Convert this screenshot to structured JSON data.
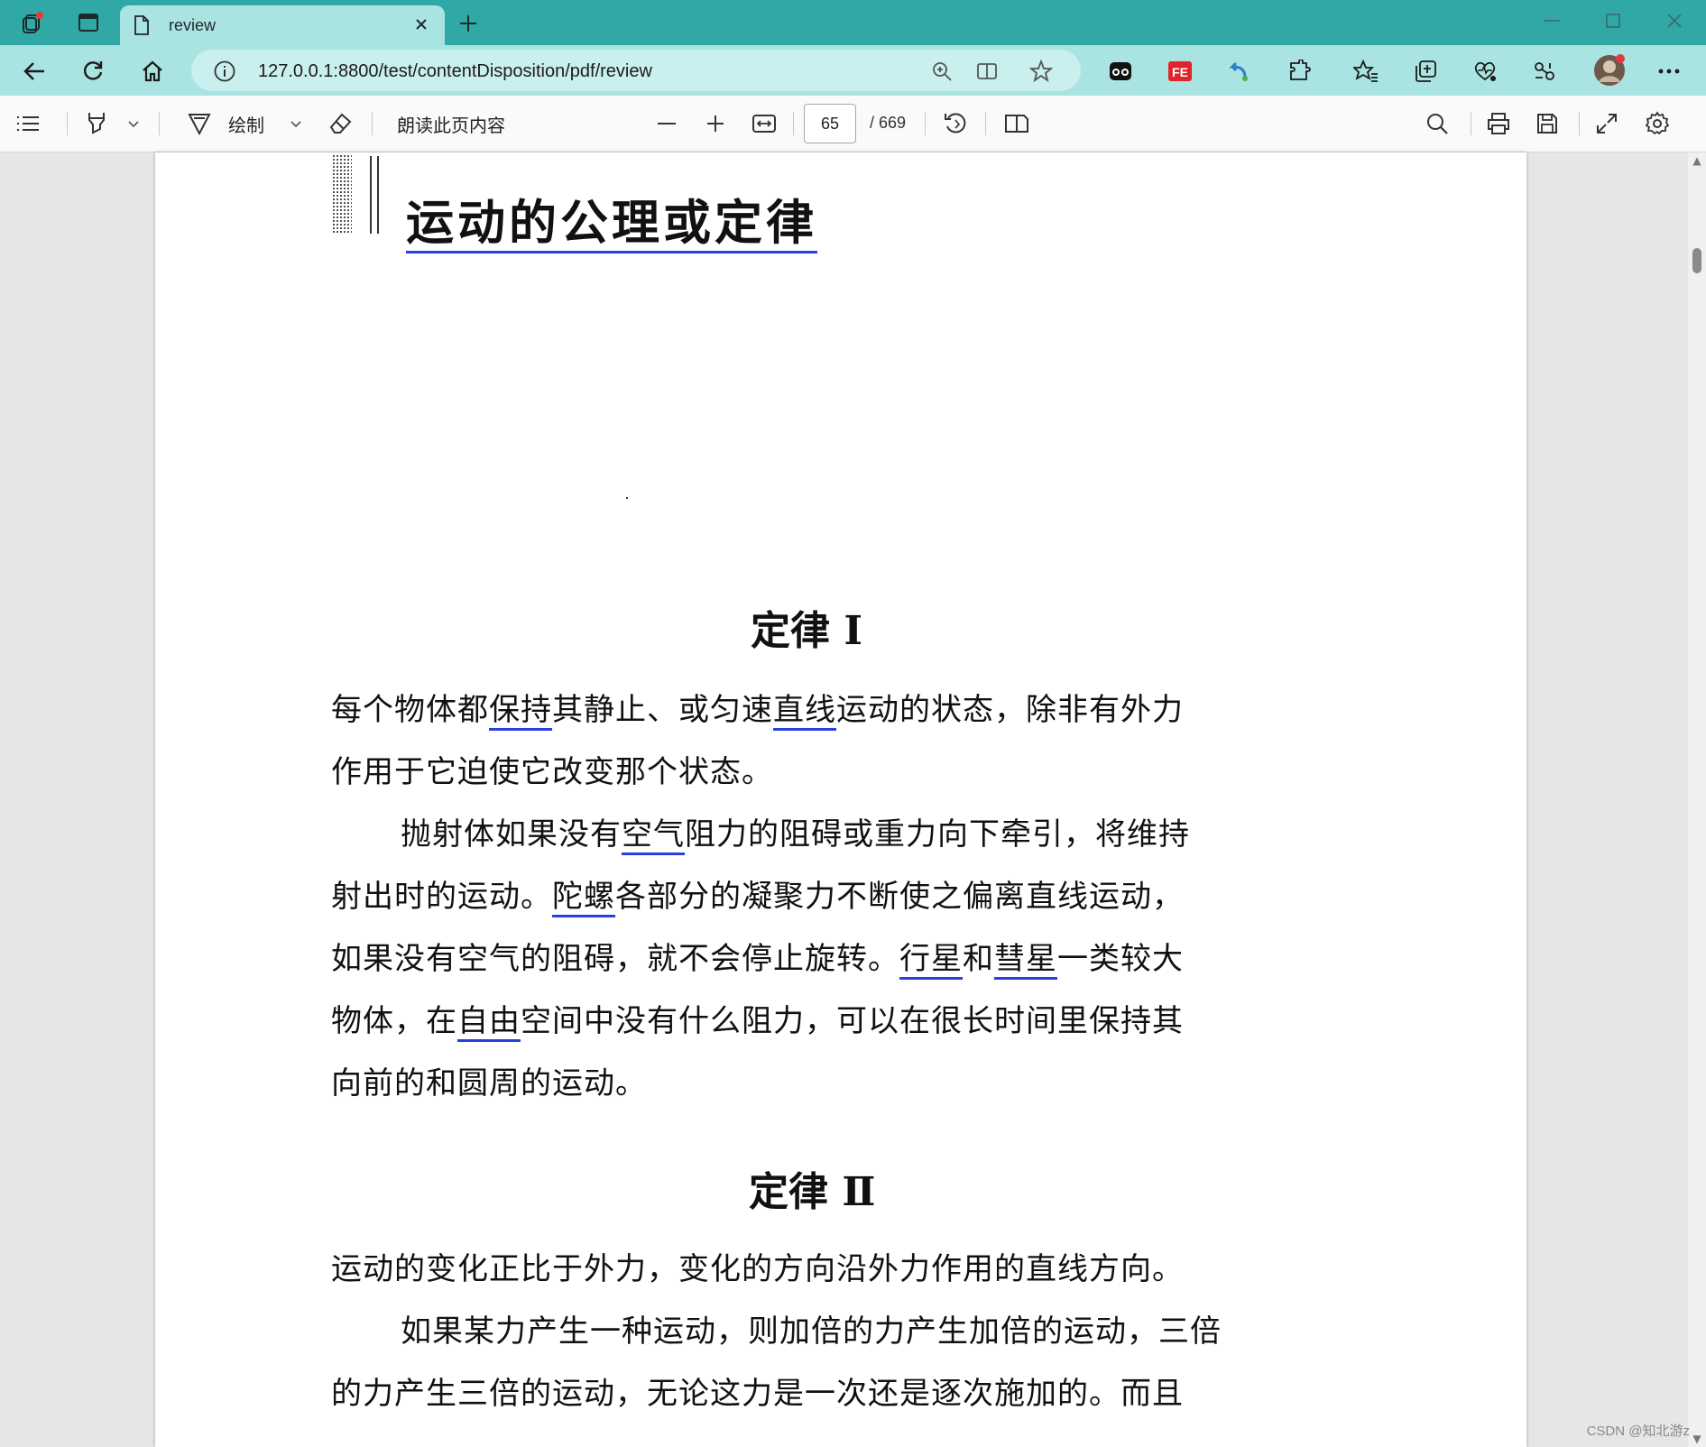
{
  "tab": {
    "title": "review"
  },
  "address": {
    "url": "127.0.0.1:8800/test/contentDisposition/pdf/review"
  },
  "pdf_toolbar": {
    "draw_label": "绘制",
    "read_aloud_label": "朗读此页内容",
    "page_number": "65",
    "page_total": "/ 669"
  },
  "document": {
    "chapter_title": "运动的公理或定律",
    "law1": {
      "heading": "定律 Ⅰ",
      "statement_lines": [
        [
          "每个物体都",
          "保持",
          "其静止、或匀速",
          "直线",
          "运动的状态，除非有外力"
        ],
        [
          "作用于它迫使它改变那个状态。"
        ]
      ],
      "explanation_lines": [
        [
          "抛射体如果没有",
          "空气",
          "阻力的阻碍或重力向下牵引，将维持"
        ],
        [
          "射出时的运动。",
          "陀螺",
          "各部分的凝聚力不断使之偏离直线运动，"
        ],
        [
          "如果没有空气的阻碍，就不会停止旋转。",
          "行星",
          "和",
          "彗星",
          "一类较大"
        ],
        [
          "物体，在",
          "自由",
          "空间中没有什么阻力，可以在很长时间里保持其"
        ],
        [
          "向前的和圆周的运动。"
        ]
      ]
    },
    "law2": {
      "heading": "定律 Ⅱ",
      "statement": "运动的变化正比于外力，变化的方向沿外力作用的直线方向。",
      "explanation_lines": [
        "如果某力产生一种运动，则加倍的力产生加倍的运动，三倍",
        "的力产生三倍的运动，无论这力是一次还是逐次施加的。而且"
      ]
    }
  },
  "watermark": "CSDN @知北游z",
  "colors": {
    "tabstrip": "#30a9a6",
    "navbar": "#a9e3e2",
    "omnibox": "#c9efee",
    "underline": "#2a3fe0"
  },
  "icons": [
    "workspaces-icon",
    "tab-actions-icon",
    "page-icon",
    "close-icon",
    "new-tab-icon",
    "minimize-icon",
    "maximize-icon",
    "window-close-icon",
    "back-icon",
    "refresh-icon",
    "home-icon",
    "info-icon",
    "zoom-icon",
    "read-view-icon",
    "favorite-star-icon",
    "extension-icon",
    "favorites-icon",
    "collections-icon",
    "performance-icon",
    "share-icon",
    "profile-avatar",
    "more-icon",
    "contents-list-icon",
    "highlight-icon",
    "draw-icon",
    "eraser-icon",
    "zoom-out-icon",
    "zoom-in-icon",
    "fit-width-icon",
    "rotate-icon",
    "page-view-icon",
    "search-icon",
    "print-icon",
    "save-icon",
    "fullscreen-icon",
    "settings-icon"
  ]
}
